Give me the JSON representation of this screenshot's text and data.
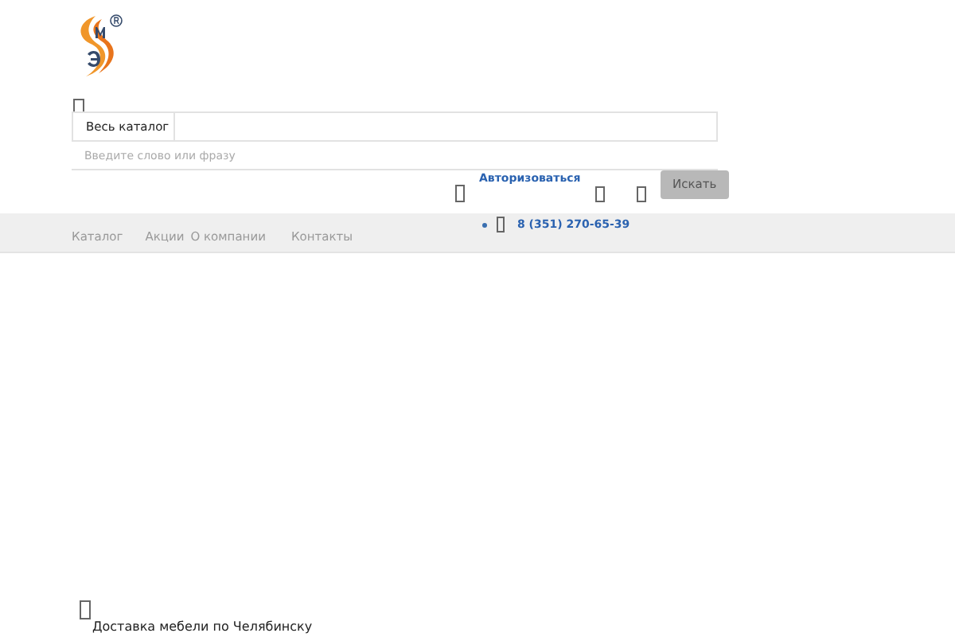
{
  "search": {
    "category": "Весь каталог",
    "placeholder": "Введите слово или фразу",
    "button": "Искать"
  },
  "login": "Авторизоваться",
  "phone": "8 (351) 270-65-39",
  "nav": [
    "Каталог",
    "Акции",
    "О компании",
    "Контакты"
  ],
  "delivery": "Доставка мебели по Челябинску"
}
